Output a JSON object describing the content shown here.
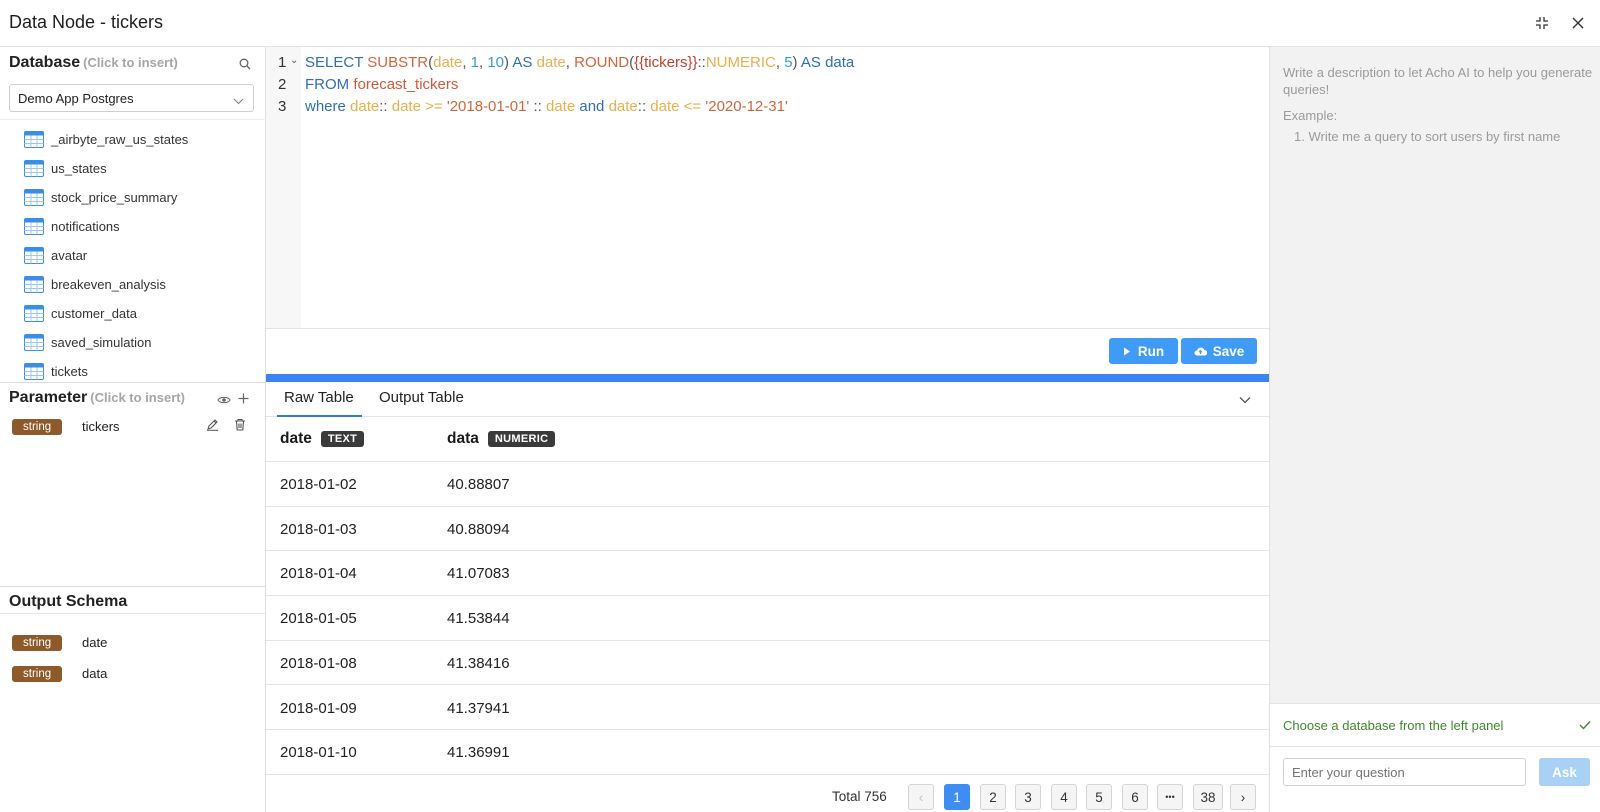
{
  "window": {
    "title": "Data Node - tickers"
  },
  "database": {
    "heading": "Database",
    "hint": "(Click to insert)",
    "selected": "Demo App Postgres",
    "tables": [
      "_airbyte_raw_us_states",
      "us_states",
      "stock_price_summary",
      "notifications",
      "avatar",
      "breakeven_analysis",
      "customer_data",
      "saved_simulation",
      "tickets"
    ]
  },
  "parameter": {
    "heading": "Parameter",
    "hint": "(Click to insert)",
    "items": [
      {
        "type": "string",
        "name": "tickers"
      }
    ]
  },
  "schema": {
    "heading": "Output Schema",
    "items": [
      {
        "type": "string",
        "name": "date"
      },
      {
        "type": "string",
        "name": "data"
      }
    ]
  },
  "editor": {
    "line_numbers": [
      "1",
      "2",
      "3"
    ],
    "lines": [
      "SELECT SUBSTR(date, 1, 10) AS date, ROUND({{tickers}}::NUMERIC, 5) AS data",
      "FROM forecast_tickers",
      "where date:: date >= '2018-01-01' :: date and date:: date <= '2020-12-31'"
    ]
  },
  "toolbar": {
    "run_label": "Run",
    "save_label": "Save"
  },
  "results": {
    "tabs": [
      "Raw Table",
      "Output Table"
    ],
    "active_tab": "Raw Table",
    "columns": [
      {
        "name": "date",
        "type": "TEXT"
      },
      {
        "name": "data",
        "type": "NUMERIC"
      }
    ],
    "rows": [
      [
        "2018-01-02",
        "40.88807"
      ],
      [
        "2018-01-03",
        "40.88094"
      ],
      [
        "2018-01-04",
        "41.07083"
      ],
      [
        "2018-01-05",
        "41.53844"
      ],
      [
        "2018-01-08",
        "41.38416"
      ],
      [
        "2018-01-09",
        "41.37941"
      ],
      [
        "2018-01-10",
        "41.36991"
      ]
    ]
  },
  "pagination": {
    "total_label": "Total 756",
    "pages": [
      "1",
      "2",
      "3",
      "4",
      "5",
      "6",
      "•••",
      "38"
    ],
    "current": "1"
  },
  "assistant": {
    "description": "Write a description to let Acho AI to help you generate queries!",
    "example_label": "Example:",
    "example_item": "1. Write me a query to sort users by first name",
    "status_message": "Choose a database from the left panel",
    "input_placeholder": "Enter your question",
    "ask_label": "Ask"
  },
  "colors": {
    "accent": "#3f9bf6",
    "progress": "#3d84f3",
    "string_badge": "#8f5a29",
    "success": "#3d8a2b"
  }
}
